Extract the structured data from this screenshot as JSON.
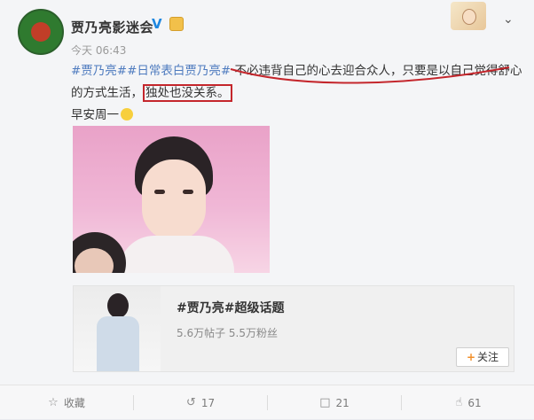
{
  "post": {
    "account_name": "贾乃亮影迷会",
    "verified_mark": "V",
    "time": "今天 06:43",
    "hashtag1": "#贾乃亮#",
    "hashtag2": "#日常表白贾乃亮#",
    "text_part1": "不必违背自己的心去迎合众人，只要是以自己觉得舒心的方式生活，",
    "text_boxed": "独处也没关系。",
    "line3": "早安周一"
  },
  "topic_card": {
    "title": "#贾乃亮#超级话题",
    "stats": "5.6万帖子 5.5万粉丝",
    "follow_label": "关注",
    "follow_plus": "+"
  },
  "actions": {
    "favorite_label": "收藏",
    "repost_count": "17",
    "comment_count": "21",
    "like_count": "61"
  },
  "icons": {
    "chevron": "chevron-down-icon",
    "favorite": "star-icon",
    "repost": "repost-icon",
    "comment": "comment-icon",
    "like": "thumbs-up-icon"
  },
  "colors": {
    "hashtag": "#4e7bbf",
    "verified": "#1e87e0",
    "annotation_red": "#c4262c",
    "follow_plus": "#f28f2a"
  }
}
